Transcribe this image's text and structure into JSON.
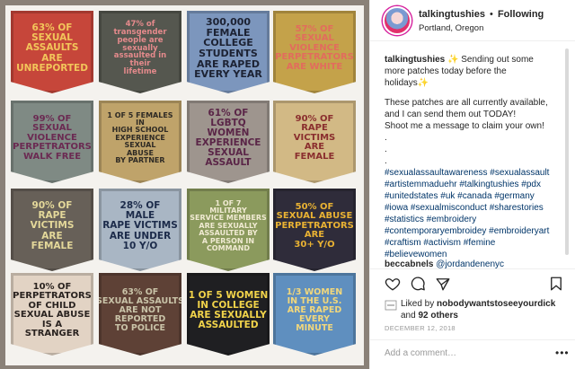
{
  "header": {
    "username": "talkingtushies",
    "separator": "•",
    "follow_label": "Following",
    "location": "Portland, Oregon"
  },
  "caption": {
    "user": "talkingtushies",
    "lines": [
      "✨ Sending out some",
      "more patches today before the",
      "holidays✨",
      "",
      "These patches are all currently available,",
      "and I can send them out TODAY!",
      "Shoot me a message to claim your own!",
      ".",
      ".",
      "."
    ],
    "hashtags": [
      "#sexualassaultawareness #sexualassault",
      "#artistemmaduehr #talkingtushies #pdx",
      "#unitedstates #uk #canada #germany",
      "#iowa #sexualmisconduct #sharestories",
      "#statistics #embroidery",
      "#contemporaryembroidey #embroideryart",
      "#craftism #activism #femine",
      "#believewomen"
    ]
  },
  "comment": {
    "user": "beccabnels",
    "mention": "@jordandenenyc"
  },
  "actions": {
    "like_icon": "heart-icon",
    "comment_icon": "comment-icon",
    "share_icon": "share-icon",
    "save_icon": "bookmark-icon"
  },
  "likes": {
    "prefix": "Liked by",
    "user": "nobodywantstoseeyourdick",
    "and": "and",
    "others": "92 others"
  },
  "date": "DECEMBER 12, 2018",
  "add_comment": {
    "placeholder": "Add a comment…",
    "more": "•••"
  },
  "patches": [
    {
      "bg": "#c6463a",
      "fg": "#f2c55a",
      "size": 10.5,
      "lines": [
        "63% OF",
        "SEXUAL",
        "ASSAULTS",
        "ARE",
        "UNREPORTED"
      ]
    },
    {
      "bg": "#55574f",
      "fg": "#e58a8c",
      "size": 10,
      "lines": [
        "47% of",
        "transgender",
        "people are",
        "sexually",
        "assaulted in",
        "their",
        "lifetime"
      ]
    },
    {
      "bg": "#7c96bd",
      "fg": "#1c2233",
      "size": 11,
      "lines": [
        "300,000",
        "FEMALE",
        "COLLEGE",
        "STUDENTS",
        "ARE RAPED",
        "EVERY YEAR"
      ]
    },
    {
      "bg": "#c4a24a",
      "fg": "#e26c5d",
      "size": 10,
      "lines": [
        "57% OF",
        "SEXUAL",
        "VIOLENCE",
        "PERPETRATORS",
        "ARE WHITE"
      ]
    },
    {
      "bg": "#7f8a84",
      "fg": "#6b2a52",
      "size": 10,
      "lines": [
        "99% OF",
        "SEXUAL",
        "VIOLENCE",
        "PERPETRATORS",
        "WALK FREE"
      ]
    },
    {
      "bg": "#bfa36a",
      "fg": "#2e2a24",
      "size": 9.5,
      "lines": [
        "1 OF 5 FEMALES",
        "IN",
        "HIGH SCHOOL",
        "EXPERIENCE",
        "SEXUAL",
        "ABUSE",
        "BY PARTNER"
      ]
    },
    {
      "bg": "#9e958e",
      "fg": "#5a2547",
      "size": 10.5,
      "lines": [
        "61% OF",
        "LGBTQ",
        "WOMEN",
        "EXPERIENCE",
        "SEXUAL",
        "ASSAULT"
      ]
    },
    {
      "bg": "#d2b985",
      "fg": "#8a2e2e",
      "size": 10,
      "lines": [
        "90% OF",
        "RAPE",
        "VICTIMS",
        "ARE",
        "FEMALE"
      ]
    },
    {
      "bg": "#676058",
      "fg": "#e4d89a",
      "size": 10.5,
      "lines": [
        "90% OF",
        "RAPE",
        "VICTIMS",
        "ARE",
        "FEMALE"
      ]
    },
    {
      "bg": "#a9b6c4",
      "fg": "#1c2b4a",
      "size": 10.5,
      "lines": [
        "28% OF",
        "MALE",
        "RAPE VICTIMS",
        "ARE UNDER",
        "10 Y/O"
      ]
    },
    {
      "bg": "#8b9a5d",
      "fg": "#f0ead2",
      "size": 9.5,
      "lines": [
        "1 OF 7",
        "MILITARY",
        "SERVICE MEMBERS",
        "ARE SEXUALLY",
        "ASSAULTED BY",
        "A PERSON IN",
        "COMMAND"
      ]
    },
    {
      "bg": "#2f2c3a",
      "fg": "#e9b233",
      "size": 10,
      "lines": [
        "50% OF",
        "SEXUAL ABUSE",
        "PERPETRATORS",
        "ARE",
        "30+ Y/O"
      ]
    },
    {
      "bg": "#e2d3c4",
      "fg": "#2a2320",
      "size": 10,
      "lines": [
        "10% OF",
        "PERPETRATORS",
        "OF CHILD",
        "SEXUAL ABUSE",
        "IS A",
        "STRANGER"
      ]
    },
    {
      "bg": "#5e4136",
      "fg": "#c9c3a8",
      "size": 9.5,
      "lines": [
        "63% OF",
        "SEXUAL ASSAULTS",
        "ARE NOT",
        "REPORTED",
        "TO POLICE"
      ]
    },
    {
      "bg": "#1f1f22",
      "fg": "#f1d34a",
      "size": 10.5,
      "lines": [
        "1 OF 5 WOMEN",
        "IN COLLEGE",
        "ARE SEXUALLY",
        "ASSAULTED"
      ]
    },
    {
      "bg": "#5f8fbf",
      "fg": "#f1d77c",
      "size": 9.5,
      "lines": [
        "1/3 WOMEN",
        "IN THE U.S.",
        "ARE RAPED",
        "EVERY",
        "MINUTE"
      ]
    }
  ]
}
